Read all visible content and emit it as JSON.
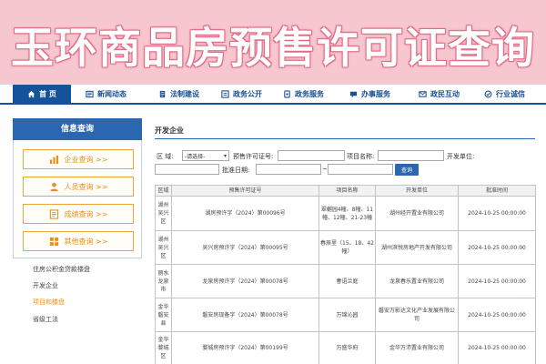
{
  "banner": {
    "title": "玉环商品房预售许可证查询"
  },
  "nav": {
    "items": [
      {
        "label": "首 页",
        "icon": "home-icon"
      },
      {
        "label": "新闻动态",
        "icon": "news-icon"
      },
      {
        "label": "法制建设",
        "icon": "law-icon"
      },
      {
        "label": "政务公开",
        "icon": "gov-open-icon"
      },
      {
        "label": "政务服务",
        "icon": "gov-service-icon"
      },
      {
        "label": "办事服务",
        "icon": "affairs-icon"
      },
      {
        "label": "政民互动",
        "icon": "interaction-icon"
      },
      {
        "label": "行业诚信",
        "icon": "integrity-icon"
      }
    ]
  },
  "sidebar": {
    "title": "信息查询",
    "buttons": [
      {
        "label": "企业查询 >>",
        "icon": "chart-icon"
      },
      {
        "label": "人员查询 >>",
        "icon": "person-icon"
      },
      {
        "label": "成绩查询 >>",
        "icon": "grade-icon"
      },
      {
        "label": "其他查询 >>",
        "icon": "grid-icon"
      }
    ],
    "links": [
      "住房公积金贷款楼盘",
      "开发企业",
      "项目和楼盘",
      "省级工法"
    ]
  },
  "main": {
    "title": "开发企业",
    "filters": {
      "region_label": "区 域:",
      "region_value": "-请选择-",
      "permit_label": "预售许可证号:",
      "project_label": "项目名称:",
      "developer_label": "开发单位:",
      "date_label": "批准日期:",
      "date_sep": "~",
      "search_label": "查询"
    },
    "table": {
      "headers": [
        "区域",
        "预售许可证号",
        "项目名称",
        "开发单位",
        "批准时间"
      ],
      "rows": [
        [
          "湖州吴兴区",
          "湖房预许字（2024）第00096号",
          "翠樾园4幢、8幢、11幢、12幢、21-23幢",
          "湖州经开置业有限公司",
          "2024-10-25 00:00:00"
        ],
        [
          "湖州吴兴区",
          "吴兴房预许字（2024）第00095号",
          "春辰里（15、18、42幢）",
          "湖州滨悦房地产开发有限公司",
          "2024-10-25 00:00:00"
        ],
        [
          "丽水龙泉市",
          "龙泉房预许字（2024）第00078号",
          "春语兰庭",
          "龙泉春乐置业有限公司",
          "2024-10-25 00:00:00"
        ],
        [
          "金华磐安县",
          "磐安房现备字（2024）第00078号",
          "万锦沁园",
          "磐安万影达文化产业发展有限公司",
          "2024-10-25 00:00:00"
        ],
        [
          "金华婺城区",
          "婺城房预许字（2024）第00199号",
          "万盛华府",
          "金华万沛置业有限公司",
          "2024-10-25 00:00:00"
        ]
      ]
    }
  }
}
